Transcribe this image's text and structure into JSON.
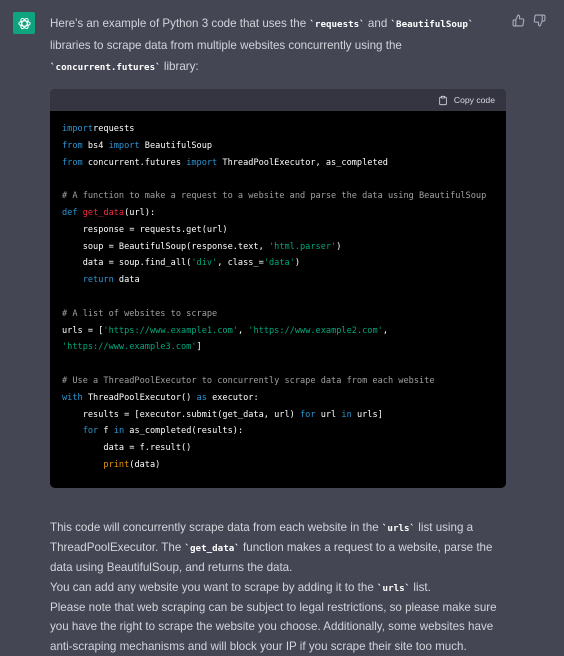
{
  "message": {
    "intro": {
      "t1": "Here's an example of Python 3 code that uses the ",
      "c1": "`requests`",
      "t2": " and ",
      "c2": "`BeautifulSoup`",
      "t3": " libraries to scrape data from multiple websites concurrently using the ",
      "c3": "`concurrent.futures`",
      "t4": " library:"
    },
    "code_block": {
      "copy_label": "Copy code",
      "lines": [
        [
          [
            "kw",
            "import"
          ],
          [
            "",
            "requests"
          ]
        ],
        [
          [
            "kw",
            "from"
          ],
          [
            "",
            " bs4 "
          ],
          [
            "kw",
            "import"
          ],
          [
            "",
            " BeautifulSoup"
          ]
        ],
        [
          [
            "kw",
            "from"
          ],
          [
            "",
            " concurrent.futures "
          ],
          [
            "kw",
            "import"
          ],
          [
            "",
            " ThreadPoolExecutor, as_completed"
          ]
        ],
        [],
        [
          [
            "cm",
            "# A function to make a request to a website and parse the data using BeautifulSoup"
          ]
        ],
        [
          [
            "kw",
            "def"
          ],
          [
            "",
            " "
          ],
          [
            "fn",
            "get_data"
          ],
          [
            "",
            "(url):"
          ]
        ],
        [
          [
            "",
            "    response = requests.get(url)"
          ]
        ],
        [
          [
            "",
            "    soup = BeautifulSoup(response.text, "
          ],
          [
            "str",
            "'html.parser'"
          ],
          [
            "",
            ")"
          ]
        ],
        [
          [
            "",
            "    data = soup.find_all("
          ],
          [
            "str",
            "'div'"
          ],
          [
            "",
            ", class_="
          ],
          [
            "str",
            "'data'"
          ],
          [
            "",
            ")"
          ]
        ],
        [
          [
            "",
            "    "
          ],
          [
            "kw",
            "return"
          ],
          [
            "",
            " data"
          ]
        ],
        [],
        [
          [
            "cm",
            "# A list of websites to scrape"
          ]
        ],
        [
          [
            "",
            "urls = ["
          ],
          [
            "str",
            "'https://www.example1.com'"
          ],
          [
            "",
            ", "
          ],
          [
            "str",
            "'https://www.example2.com'"
          ],
          [
            "",
            ","
          ]
        ],
        [
          [
            "str",
            "'https://www.example3.com'"
          ],
          [
            "",
            "]"
          ]
        ],
        [],
        [
          [
            "cm",
            "# Use a ThreadPoolExecutor to concurrently scrape data from each website"
          ]
        ],
        [
          [
            "kw",
            "with"
          ],
          [
            "",
            " ThreadPoolExecutor() "
          ],
          [
            "kw",
            "as"
          ],
          [
            "",
            " executor:"
          ]
        ],
        [
          [
            "",
            "    results = [executor.submit(get_data, url) "
          ],
          [
            "kw",
            "for"
          ],
          [
            "",
            " url "
          ],
          [
            "kw",
            "in"
          ],
          [
            "",
            " urls]"
          ]
        ],
        [
          [
            "",
            "    "
          ],
          [
            "kw",
            "for"
          ],
          [
            "",
            " f "
          ],
          [
            "kw",
            "in"
          ],
          [
            "",
            " as_completed(results):"
          ]
        ],
        [
          [
            "",
            "        data = f.result()"
          ]
        ],
        [
          [
            "",
            "        "
          ],
          [
            "bi",
            "print"
          ],
          [
            "",
            "(data)"
          ]
        ]
      ]
    },
    "outro": {
      "p1": {
        "t1": "This code will concurrently scrape data from each website in the ",
        "c1": "`urls`",
        "t2": " list using a ThreadPoolExecutor. The ",
        "c2": "`get_data`",
        "t3": " function makes a request to a website, parse the data using BeautifulSoup, and returns the data."
      },
      "p2": {
        "t1": "You can add any website you want to scrape by adding it to the ",
        "c1": "`urls`",
        "t2": " list."
      },
      "p3": "Please note that web scraping can be subject to legal restrictions, so please make sure you have the right to scrape the website you choose. Additionally, some websites have anti-scraping mechanisms and will block your IP if you scrape their site too much."
    }
  },
  "colors": {
    "background": "#444654",
    "avatar": "#10a37f",
    "code_bg": "#000000",
    "code_header": "#343541",
    "keyword": "#2e95d3",
    "function_name": "#f22c3d",
    "string": "#00a67d",
    "comment": "#a0a0a0",
    "builtin": "#e9950c"
  },
  "icons": {
    "avatar": "openai-logo-icon",
    "thumbs_up": "thumbs-up-icon",
    "thumbs_down": "thumbs-down-icon",
    "copy": "clipboard-icon"
  }
}
